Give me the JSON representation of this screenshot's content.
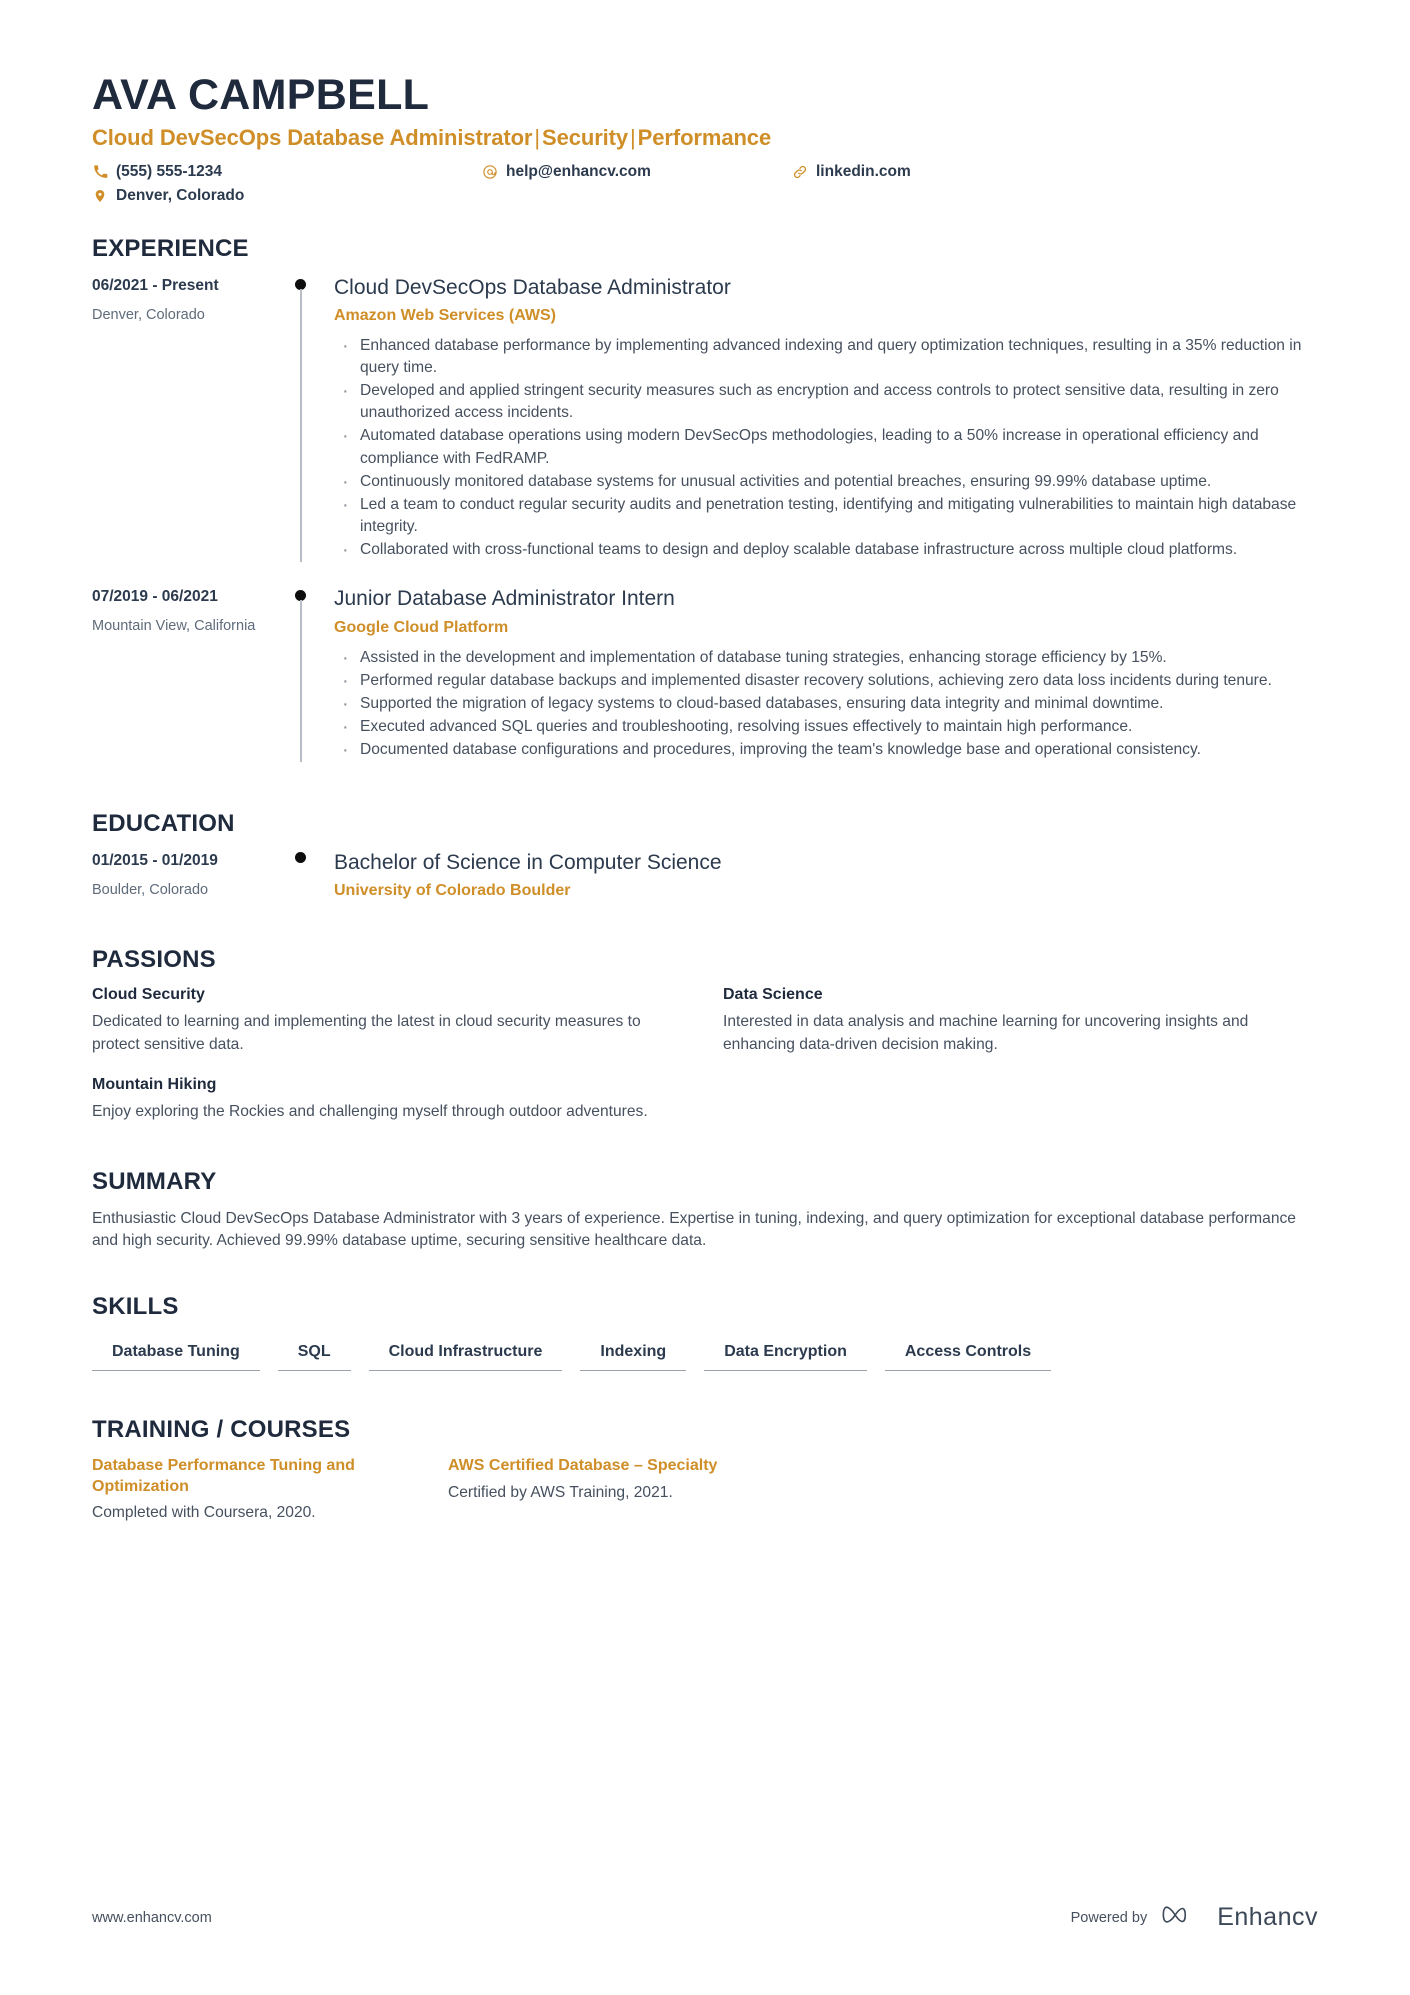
{
  "accent_color": "#cf8e27",
  "heading_color": "#1f2a3d",
  "body_color": "#46505e",
  "header": {
    "name": "AVA CAMPBELL",
    "headline_parts": [
      "Cloud DevSecOps Database Administrator",
      "Security",
      "Performance"
    ],
    "headline_separator": "|",
    "contacts": [
      {
        "icon": "phone-icon",
        "text": "(555) 555-1234"
      },
      {
        "icon": "email-icon",
        "text": "help@enhancv.com"
      },
      {
        "icon": "link-icon",
        "text": "linkedin.com"
      },
      {
        "icon": "location-icon",
        "text": "Denver, Colorado"
      }
    ]
  },
  "experience": {
    "title": "EXPERIENCE",
    "entries": [
      {
        "date": "06/2021 - Present",
        "location": "Denver, Colorado",
        "job_title": "Cloud DevSecOps Database Administrator",
        "company": "Amazon Web Services (AWS)",
        "bullets": [
          "Enhanced database performance by implementing advanced indexing and query optimization techniques, resulting in a 35% reduction in query time.",
          "Developed and applied stringent security measures such as encryption and access controls to protect sensitive data, resulting in zero unauthorized access incidents.",
          "Automated database operations using modern DevSecOps methodologies, leading to a 50% increase in operational efficiency and compliance with FedRAMP.",
          "Continuously monitored database systems for unusual activities and potential breaches, ensuring 99.99% database uptime.",
          "Led a team to conduct regular security audits and penetration testing, identifying and mitigating vulnerabilities to maintain high database integrity.",
          "Collaborated with cross-functional teams to design and deploy scalable database infrastructure across multiple cloud platforms."
        ]
      },
      {
        "date": "07/2019 - 06/2021",
        "location": "Mountain View, California",
        "job_title": "Junior Database Administrator Intern",
        "company": "Google Cloud Platform",
        "bullets": [
          "Assisted in the development and implementation of database tuning strategies, enhancing storage efficiency by 15%.",
          "Performed regular database backups and implemented disaster recovery solutions, achieving zero data loss incidents during tenure.",
          "Supported the migration of legacy systems to cloud-based databases, ensuring data integrity and minimal downtime.",
          "Executed advanced SQL queries and troubleshooting, resolving issues effectively to maintain high performance.",
          "Documented database configurations and procedures, improving the team's knowledge base and operational consistency."
        ]
      }
    ]
  },
  "education": {
    "title": "EDUCATION",
    "entries": [
      {
        "date": "01/2015 - 01/2019",
        "location": "Boulder, Colorado",
        "degree": "Bachelor of Science in Computer Science",
        "school": "University of Colorado Boulder"
      }
    ]
  },
  "passions": {
    "title": "PASSIONS",
    "items": [
      {
        "name": "Cloud Security",
        "description": "Dedicated to learning and implementing the latest in cloud security measures to protect sensitive data."
      },
      {
        "name": "Data Science",
        "description": "Interested in data analysis and machine learning for uncovering insights and enhancing data-driven decision making."
      },
      {
        "name": "Mountain Hiking",
        "description": "Enjoy exploring the Rockies and challenging myself through outdoor adventures."
      }
    ]
  },
  "summary": {
    "title": "SUMMARY",
    "text": "Enthusiastic Cloud DevSecOps Database Administrator with 3 years of experience. Expertise in tuning, indexing, and query optimization for exceptional database performance and high security. Achieved 99.99% database uptime, securing sensitive healthcare data."
  },
  "skills": {
    "title": "SKILLS",
    "items": [
      "Database Tuning",
      "SQL",
      "Cloud Infrastructure",
      "Indexing",
      "Data Encryption",
      "Access Controls"
    ]
  },
  "training": {
    "title": "TRAINING / COURSES",
    "items": [
      {
        "name": "Database Performance Tuning and Optimization",
        "description": "Completed with Coursera, 2020."
      },
      {
        "name": "AWS Certified Database – Specialty",
        "description": "Certified by AWS Training, 2021."
      }
    ]
  },
  "footer": {
    "url": "www.enhancv.com",
    "powered_by": "Powered by",
    "brand": "Enhancv"
  }
}
